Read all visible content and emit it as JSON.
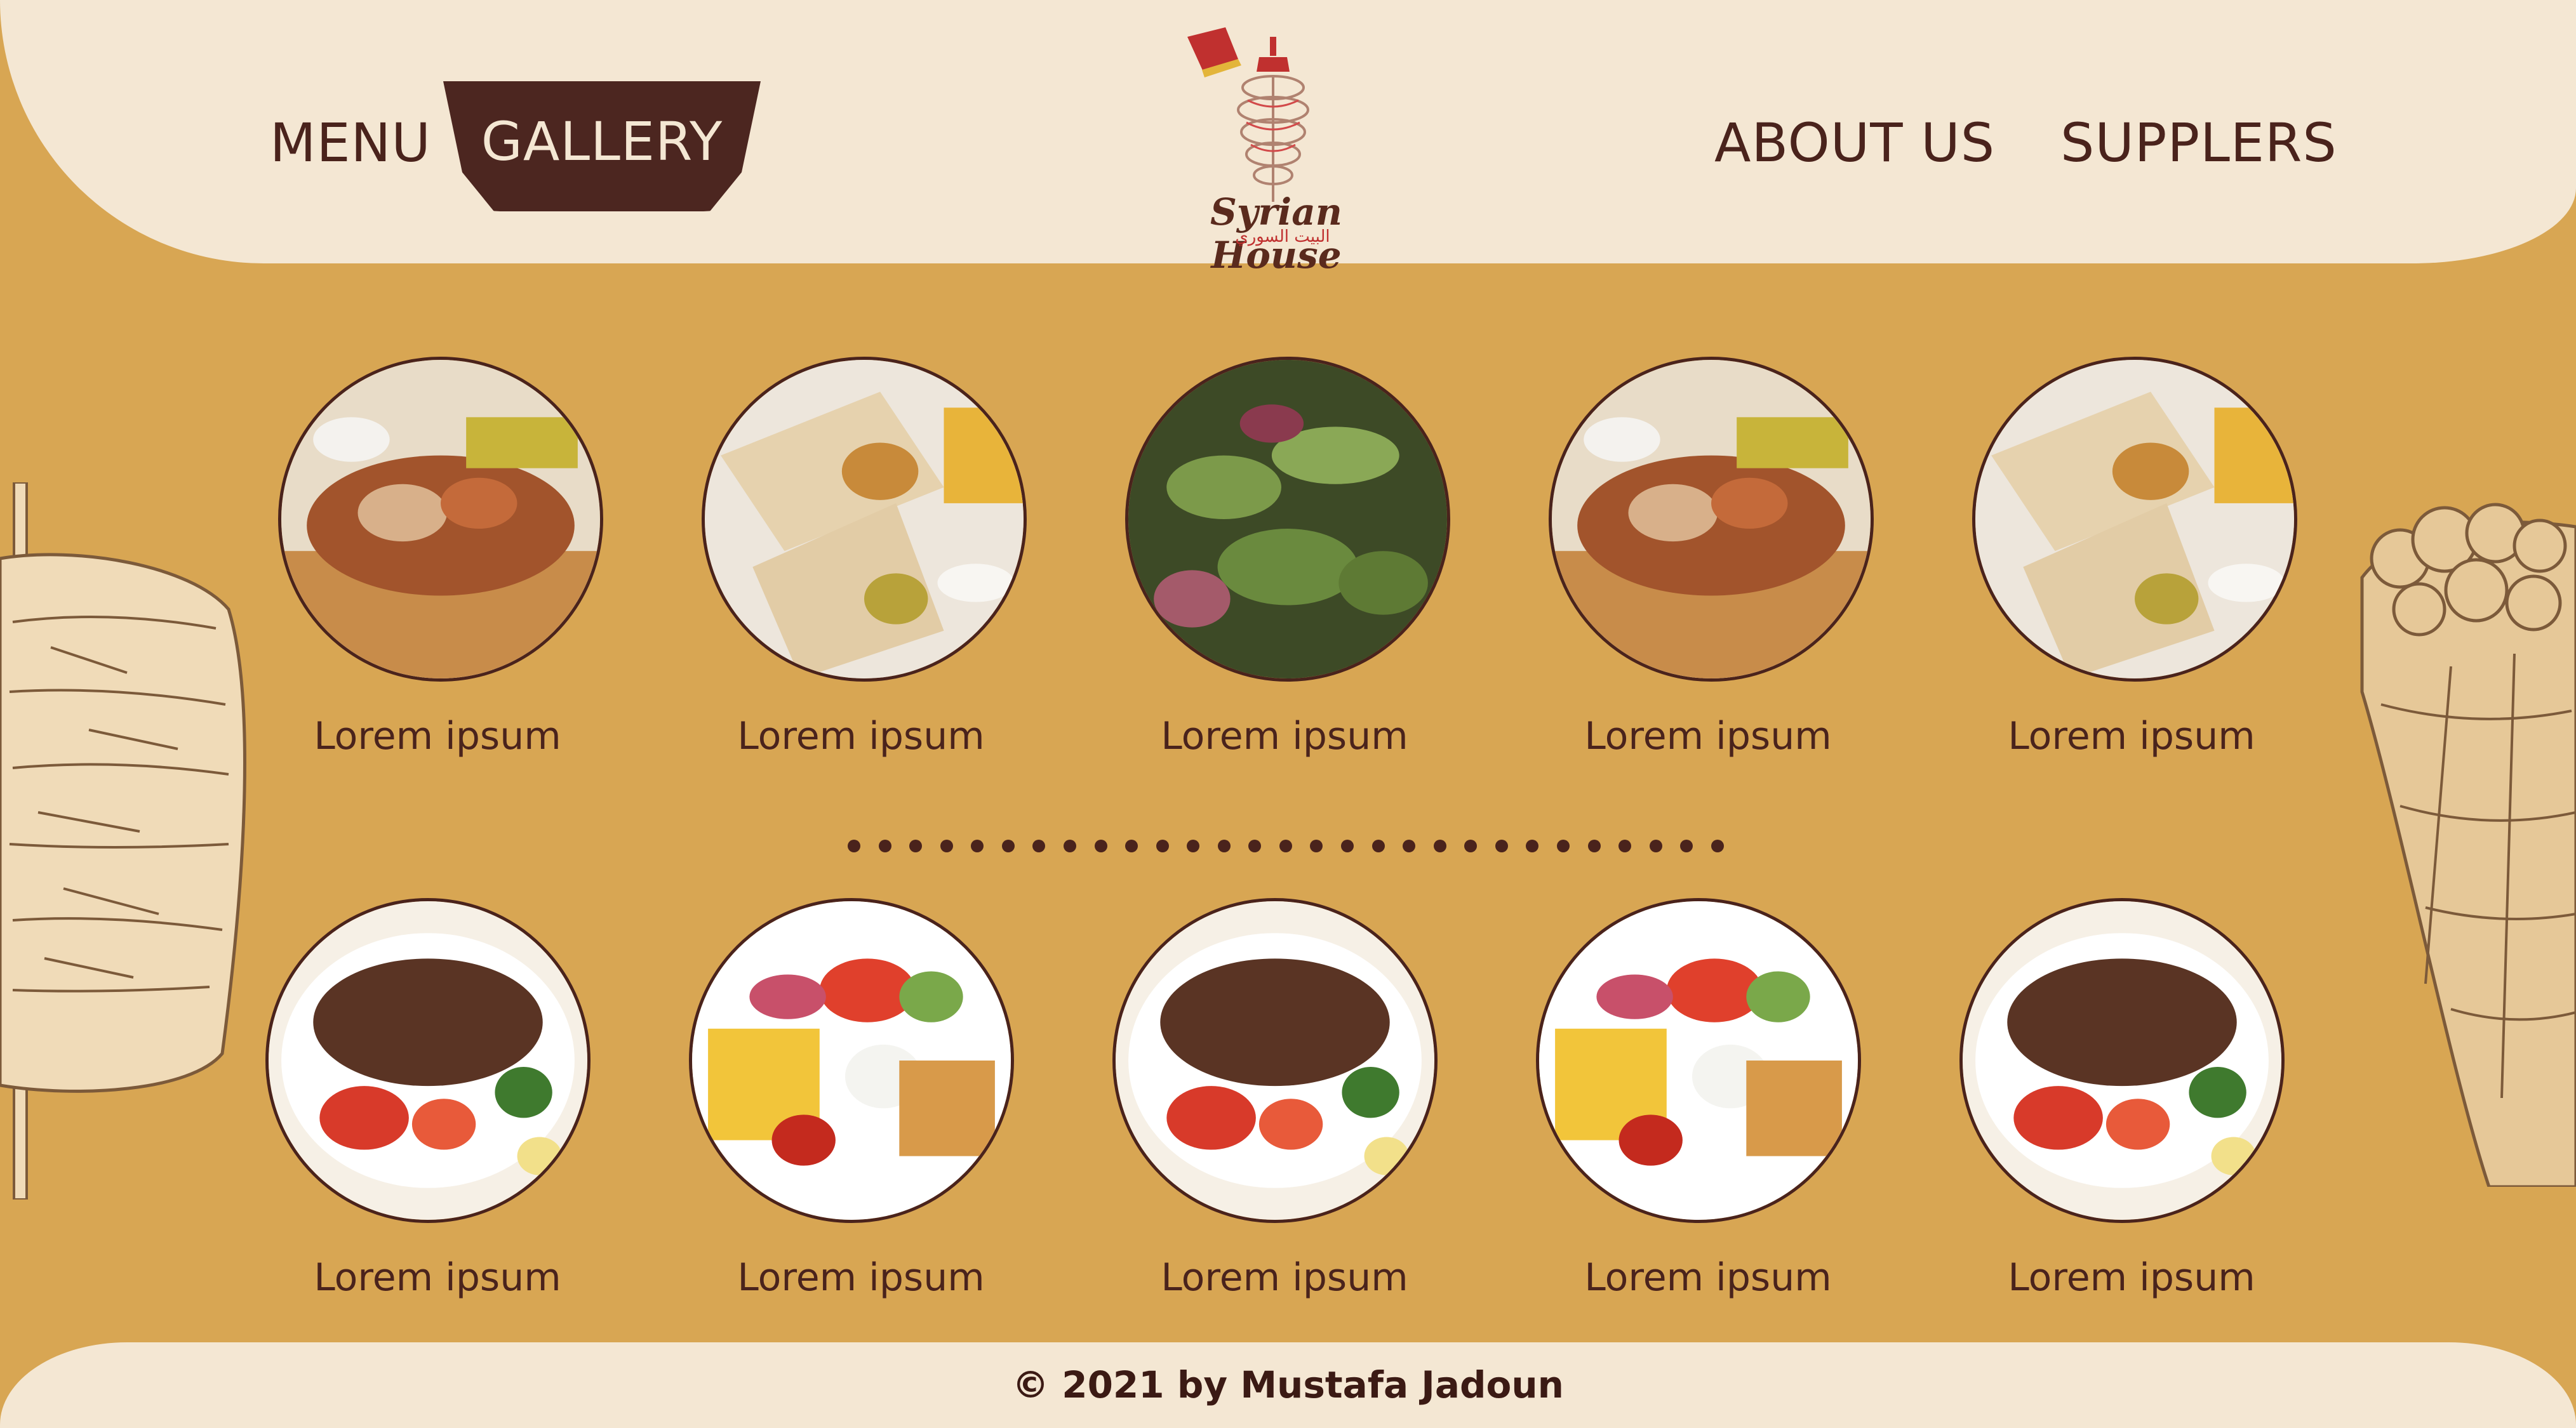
{
  "nav": {
    "menu": "MENU",
    "gallery": "GALLERY",
    "about": "ABOUT US",
    "suppliers": "SUPPLERS"
  },
  "logo": {
    "name": "Syrian House",
    "arabic": "البيت السوري"
  },
  "gallery": {
    "row1": [
      {
        "caption": "Lorem ipsum",
        "dish": "chicken-shawarma-plate"
      },
      {
        "caption": "Lorem ipsum",
        "dish": "shawarma-wrap"
      },
      {
        "caption": "Lorem ipsum",
        "dish": "cucumber-salad"
      },
      {
        "caption": "Lorem ipsum",
        "dish": "chicken-shawarma-plate"
      },
      {
        "caption": "Lorem ipsum",
        "dish": "shawarma-wrap"
      }
    ],
    "row2": [
      {
        "caption": "Lorem ipsum",
        "dish": "beef-shawarma-plate"
      },
      {
        "caption": "Lorem ipsum",
        "dish": "chicken-fries-plate"
      },
      {
        "caption": "Lorem ipsum",
        "dish": "beef-shawarma-plate"
      },
      {
        "caption": "Lorem ipsum",
        "dish": "chicken-fries-plate"
      },
      {
        "caption": "Lorem ipsum",
        "dish": "beef-shawarma-plate"
      }
    ]
  },
  "footer": {
    "copyright": "© 2021 by Mustafa Jadoun"
  },
  "colors": {
    "background": "#d8a653",
    "cream": "#f4e7d3",
    "brown": "#4a231c",
    "accent_red": "#c0302f"
  }
}
